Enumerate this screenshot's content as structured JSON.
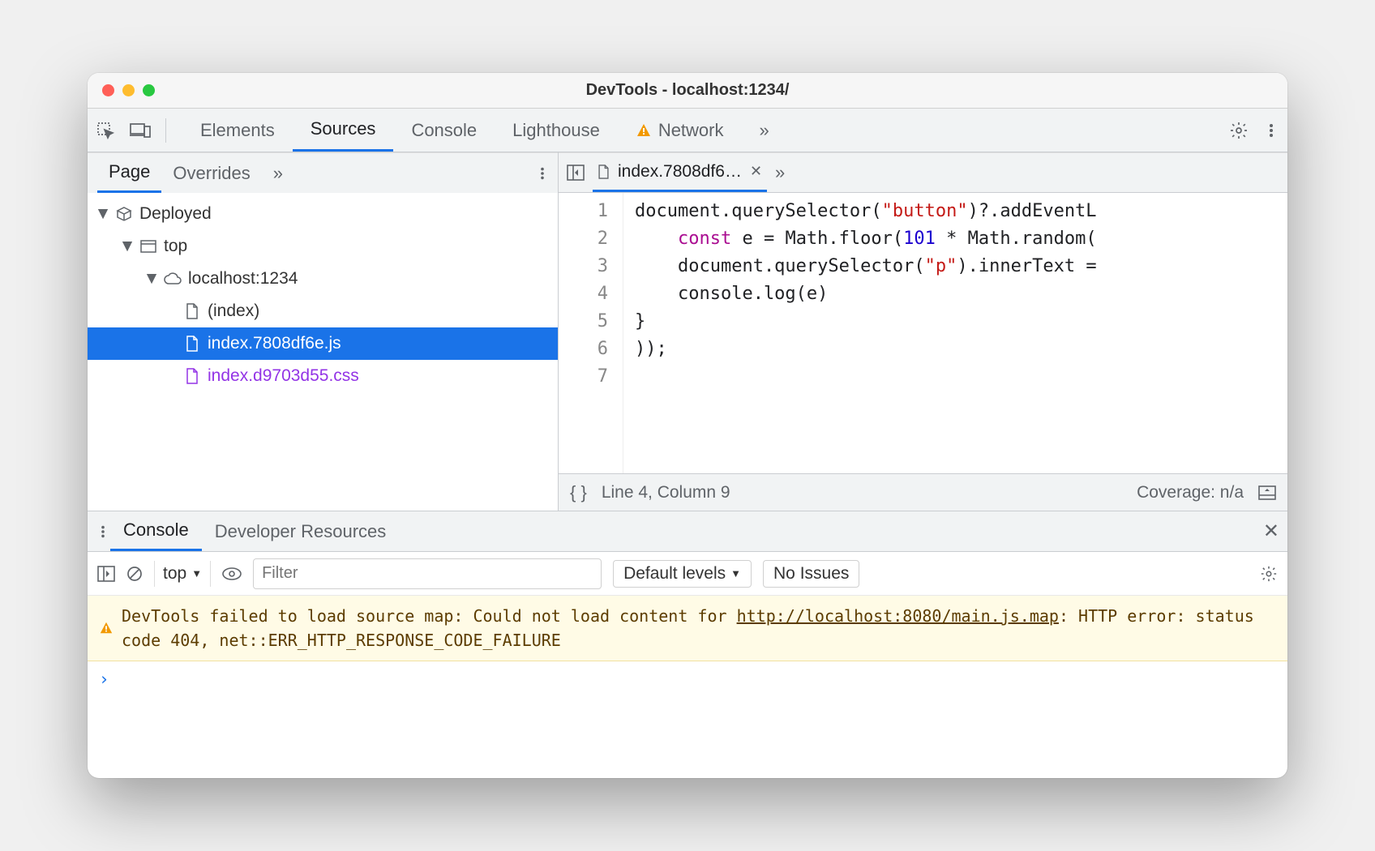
{
  "window": {
    "title": "DevTools - localhost:1234/"
  },
  "toolbar": {
    "tabs": [
      "Elements",
      "Sources",
      "Console",
      "Lighthouse",
      "Network"
    ],
    "active": "Sources",
    "more": "»"
  },
  "sidebar": {
    "tabs": [
      "Page",
      "Overrides"
    ],
    "active": "Page",
    "more": "»",
    "tree": {
      "deployed": "Deployed",
      "top": "top",
      "domain": "localhost:1234",
      "files": [
        {
          "name": "(index)",
          "kind": "html"
        },
        {
          "name": "index.7808df6e.js",
          "kind": "js",
          "selected": true
        },
        {
          "name": "index.d9703d55.css",
          "kind": "css"
        }
      ]
    }
  },
  "editor": {
    "open_file": "index.7808df6…",
    "more": "»",
    "code": {
      "line1_a": "document.querySelector(",
      "line1_b": "\"button\"",
      "line1_c": ")?.addEventL",
      "line2_a": "    ",
      "line2_kw": "const",
      "line2_b": " e = Math.floor(",
      "line2_num": "101",
      "line2_c": " * Math.random(",
      "line3_a": "    document.querySelector(",
      "line3_str": "\"p\"",
      "line3_b": ").innerText =",
      "line4": "    console.log(e)",
      "line5": "}",
      "line6": "));",
      "line7": ""
    },
    "lines": [
      "1",
      "2",
      "3",
      "4",
      "5",
      "6",
      "7"
    ]
  },
  "status": {
    "pos": "Line 4, Column 9",
    "coverage": "Coverage: n/a"
  },
  "drawer": {
    "tabs": [
      "Console",
      "Developer Resources"
    ],
    "active": "Console"
  },
  "console_toolbar": {
    "context": "top",
    "filter_placeholder": "Filter",
    "levels": "Default levels",
    "issues": "No Issues"
  },
  "console_msg": {
    "pre": "DevTools failed to load source map: Could not load content for ",
    "url": "http://localhost:8080/main.js.map",
    "post": ": HTTP error: status code 404, net::ERR_HTTP_RESPONSE_CODE_FAILURE"
  },
  "prompt": "›"
}
